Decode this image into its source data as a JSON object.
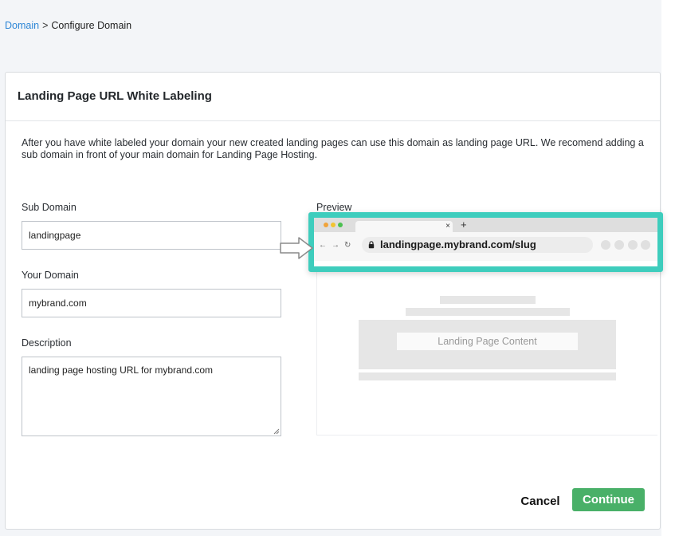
{
  "breadcrumb": {
    "parent": "Domain",
    "separator": ">",
    "current": "Configure Domain"
  },
  "card": {
    "title": "Landing Page URL White Labeling",
    "intro": "After you have white labeled your domain your new created landing pages can use this domain as landing page URL. We recomend adding a sub domain in front of your main domain for Landing Page Hosting."
  },
  "form": {
    "sub_domain": {
      "label": "Sub Domain",
      "value": "landingpage"
    },
    "your_domain": {
      "label": "Your Domain",
      "value": "mybrand.com"
    },
    "description": {
      "label": "Description",
      "value": "landing page hosting URL for mybrand.com"
    }
  },
  "preview": {
    "label": "Preview",
    "url_bold": "landingpage.mybrand.com",
    "url_path": "/slug",
    "content_label": "Landing Page Content"
  },
  "actions": {
    "cancel_label": "Cancel",
    "continue_label": "Continue"
  },
  "colors": {
    "accent": "#3ecdbd",
    "link": "#2d86d6",
    "continue": "#49b068"
  }
}
